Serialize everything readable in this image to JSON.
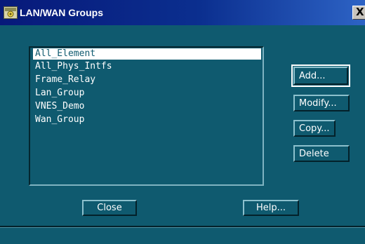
{
  "window": {
    "title": "LAN/WAN Groups",
    "close_glyph": "X"
  },
  "groups": {
    "items": [
      {
        "label": "All_Element",
        "selected": true
      },
      {
        "label": "All_Phys_Intfs",
        "selected": false
      },
      {
        "label": "Frame_Relay",
        "selected": false
      },
      {
        "label": "Lan_Group",
        "selected": false
      },
      {
        "label": "VNES_Demo",
        "selected": false
      },
      {
        "label": "Wan_Group",
        "selected": false
      }
    ]
  },
  "actions": {
    "add_label": "Add...",
    "modify_label": "Modify...",
    "copy_label": "Copy...",
    "delete_label": "Delete"
  },
  "footer": {
    "close_label": "Close",
    "help_label": "Help..."
  },
  "status_bar": {
    "text": ""
  },
  "colors": {
    "window_background": "#0f5a6f",
    "titlebar_start": "#07197a",
    "titlebar_end": "#2d63c5",
    "selection_background": "#ffffff",
    "text": "#ffffff"
  },
  "icons": {
    "app": "app-icon",
    "close": "close-icon"
  }
}
